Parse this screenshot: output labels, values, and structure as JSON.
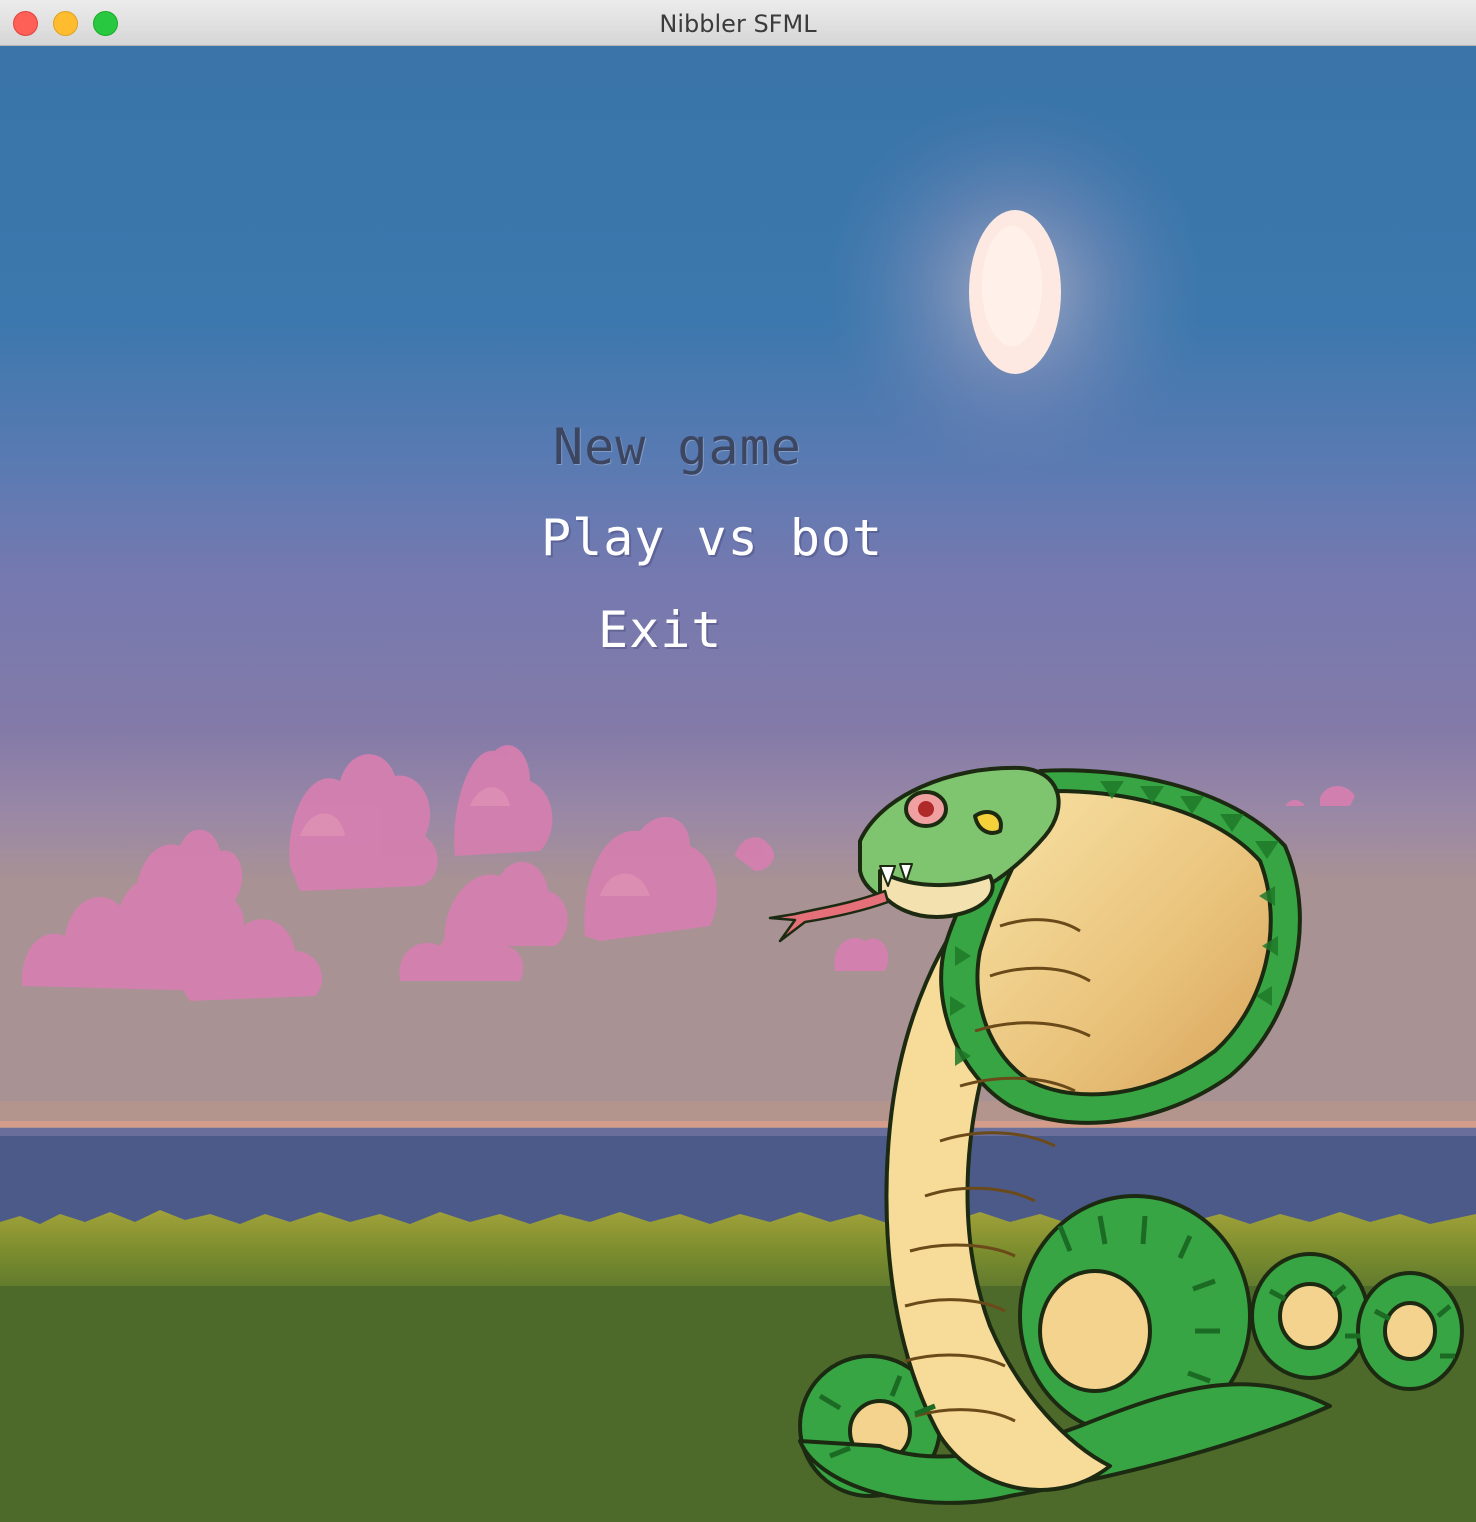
{
  "window": {
    "title": "Nibbler SFML"
  },
  "menu": {
    "items": [
      {
        "label": "New game",
        "state": "selected",
        "color": "#3d4660"
      },
      {
        "label": "Play vs bot",
        "state": "normal",
        "color": "#ffffff"
      },
      {
        "label": "Exit",
        "state": "normal",
        "color": "#ffffff"
      }
    ]
  },
  "scene": {
    "icons": [
      "moon-icon",
      "clouds",
      "sea",
      "grass",
      "cobra-snake-icon"
    ],
    "colors": {
      "sky_top": "#3a76a9",
      "sky_bottom": "#9c86a4",
      "sea": "#4c5a8a",
      "grass": "#4d6a2a",
      "snake_green": "#2a9a3a",
      "snake_belly": "#f2d08a"
    }
  }
}
